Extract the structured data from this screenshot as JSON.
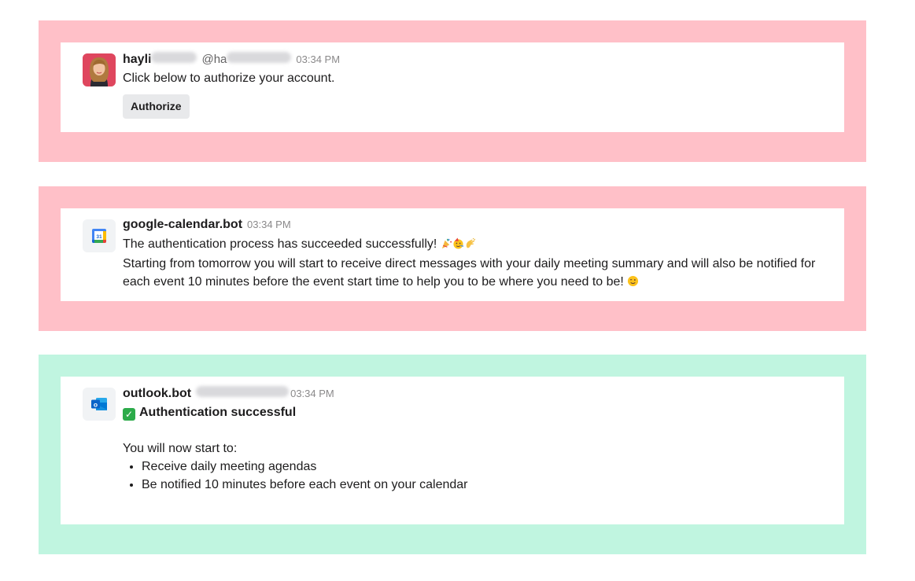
{
  "messages": [
    {
      "sender": "hayli",
      "handle": "@ha",
      "time": "03:34 PM",
      "text": "Click below to authorize your account.",
      "button": "Authorize",
      "icon": "user-avatar-photo"
    },
    {
      "sender": "google-calendar.bot",
      "time": "03:34 PM",
      "text1": "The authentication process has succeeded successfully!",
      "text2": "Starting from tomorrow you will start to receive direct messages with your daily meeting summary and will also be notified for each event 10 minutes before the event start time to help you to be where you need to be!",
      "icon": "google-calendar-icon",
      "calendar_day": "31"
    },
    {
      "sender": "outlook.bot",
      "time": "03:34 PM",
      "title": "Authentication successful",
      "intro": "You will now start to:",
      "bullets": [
        "Receive daily meeting agendas",
        "Be notified 10 minutes before each event on your calendar"
      ],
      "icon": "outlook-icon",
      "outlook_letter": "o"
    }
  ],
  "colors": {
    "pink_frame": "#ffc0c8",
    "mint_frame": "#c0f5e0",
    "success_check": "#2cab4a",
    "outlook_blue": "#0a64c8"
  }
}
